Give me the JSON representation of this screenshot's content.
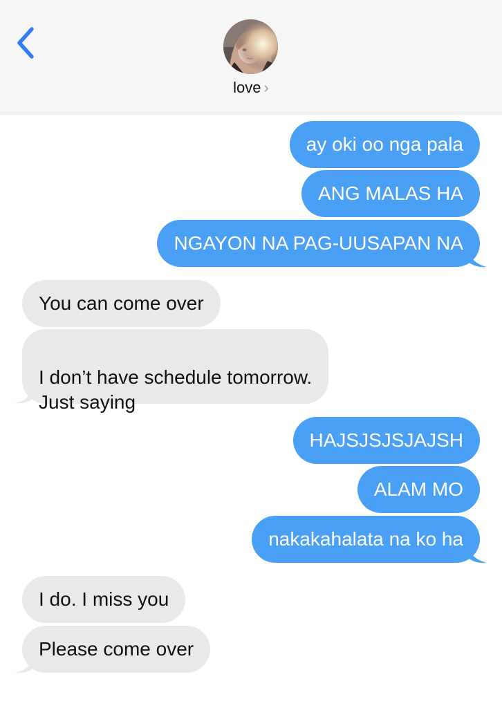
{
  "header": {
    "back_icon": "chevron-left-icon",
    "contact_name": "love",
    "name_chevron": "›",
    "accent_color": "#2f7ff2"
  },
  "colors": {
    "sent_bubble": "#4aa0f4",
    "received_bubble": "#e9e9eb",
    "header_bg": "#f6f6f6"
  },
  "messages": [
    {
      "direction": "sent",
      "text": "ay oki oo nga pala"
    },
    {
      "direction": "sent",
      "text": "ANG MALAS HA"
    },
    {
      "direction": "sent",
      "text": "NGAYON NA PAG-UUSAPAN NA"
    },
    {
      "direction": "received",
      "text": "You can come over"
    },
    {
      "direction": "received",
      "text": "I don’t have schedule tomorrow.\nJust saying"
    },
    {
      "direction": "sent",
      "text": "HAJSJSJSJAJSH"
    },
    {
      "direction": "sent",
      "text": "ALAM MO"
    },
    {
      "direction": "sent",
      "text": "nakakahalata na ko ha"
    },
    {
      "direction": "received",
      "text": "I do. I miss you"
    },
    {
      "direction": "received",
      "text": "Please come over"
    }
  ]
}
